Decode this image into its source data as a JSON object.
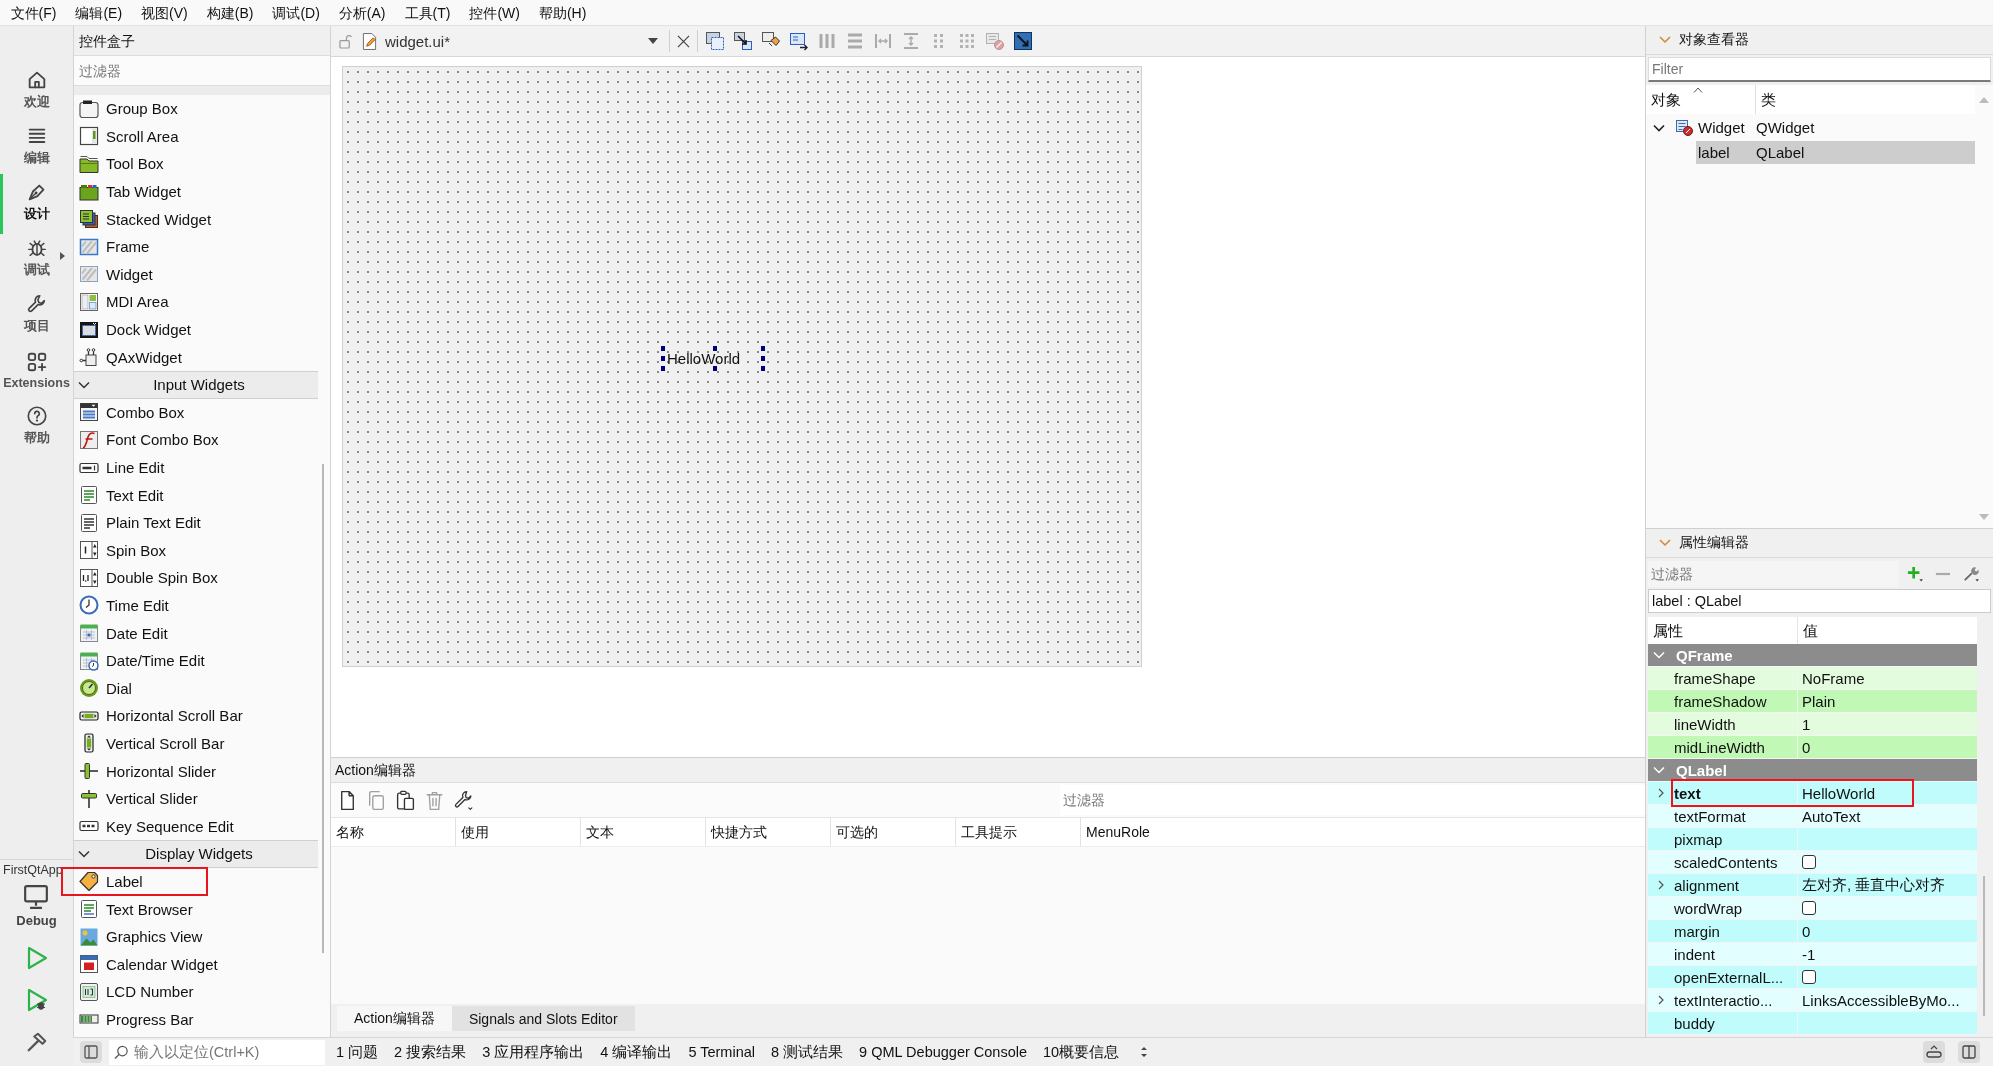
{
  "menu_bar": [
    "文件(F)",
    "编辑(E)",
    "视图(V)",
    "构建(B)",
    "调试(D)",
    "分析(A)",
    "工具(T)",
    "控件(W)",
    "帮助(H)"
  ],
  "mode_bar": {
    "modes": [
      {
        "label": "欢迎",
        "kind": "welcome",
        "selected": false,
        "submenu": false
      },
      {
        "label": "编辑",
        "kind": "edit",
        "selected": false,
        "submenu": false
      },
      {
        "label": "设计",
        "kind": "design",
        "selected": true,
        "submenu": false
      },
      {
        "label": "调试",
        "kind": "debug",
        "selected": false,
        "submenu": true
      },
      {
        "label": "项目",
        "kind": "projects",
        "selected": false,
        "submenu": false
      },
      {
        "label": "Extensions",
        "kind": "extensions",
        "selected": false,
        "submenu": false
      },
      {
        "label": "帮助",
        "kind": "help",
        "selected": false,
        "submenu": false
      }
    ],
    "project": "FirstQtApp",
    "build_config": "Debug"
  },
  "widget_box": {
    "title": "控件盒子",
    "filter": {
      "placeholder": "过滤器"
    },
    "categories": [
      {
        "items": [
          {
            "label": "Group Box",
            "kind": "groupbox",
            "highlighted": false
          },
          {
            "label": "Scroll Area",
            "kind": "scrollarea",
            "highlighted": false
          },
          {
            "label": "Tool Box",
            "kind": "toolbox",
            "highlighted": false
          },
          {
            "label": "Tab Widget",
            "kind": "tabwidget",
            "highlighted": false
          },
          {
            "label": "Stacked Widget",
            "kind": "stacked",
            "highlighted": false
          },
          {
            "label": "Frame",
            "kind": "frame",
            "highlighted": false
          },
          {
            "label": "Widget",
            "kind": "widget",
            "highlighted": false
          },
          {
            "label": "MDI Area",
            "kind": "mdi",
            "highlighted": false
          },
          {
            "label": "Dock Widget",
            "kind": "dock",
            "highlighted": false
          },
          {
            "label": "QAxWidget",
            "kind": "qax",
            "highlighted": false
          }
        ]
      },
      {
        "name": "Input Widgets",
        "expanded": true,
        "items": [
          {
            "label": "Combo Box",
            "kind": "combo",
            "highlighted": false
          },
          {
            "label": "Font Combo Box",
            "kind": "fontcombo",
            "highlighted": false
          },
          {
            "label": "Line Edit",
            "kind": "lineedit",
            "highlighted": false
          },
          {
            "label": "Text Edit",
            "kind": "textedit",
            "highlighted": false
          },
          {
            "label": "Plain Text Edit",
            "kind": "plaintext",
            "highlighted": false
          },
          {
            "label": "Spin Box",
            "kind": "spinbox",
            "highlighted": false
          },
          {
            "label": "Double Spin Box",
            "kind": "doublespin",
            "highlighted": false
          },
          {
            "label": "Time Edit",
            "kind": "timeedit",
            "highlighted": false
          },
          {
            "label": "Date Edit",
            "kind": "dateedit",
            "highlighted": false
          },
          {
            "label": "Date/Time Edit",
            "kind": "datetime",
            "highlighted": false
          },
          {
            "label": "Dial",
            "kind": "dial",
            "highlighted": false
          },
          {
            "label": "Horizontal Scroll Bar",
            "kind": "hscroll",
            "highlighted": false
          },
          {
            "label": "Vertical Scroll Bar",
            "kind": "vscroll",
            "highlighted": false
          },
          {
            "label": "Horizontal Slider",
            "kind": "hslider",
            "highlighted": false
          },
          {
            "label": "Vertical Slider",
            "kind": "vslider",
            "highlighted": false
          },
          {
            "label": "Key Sequence Edit",
            "kind": "keyseq",
            "highlighted": false
          }
        ]
      },
      {
        "name": "Display Widgets",
        "expanded": true,
        "items": [
          {
            "label": "Label",
            "kind": "label",
            "highlighted": true
          },
          {
            "label": "Text Browser",
            "kind": "textbrowser",
            "highlighted": false
          },
          {
            "label": "Graphics View",
            "kind": "graphics",
            "highlighted": false
          },
          {
            "label": "Calendar Widget",
            "kind": "calendar",
            "highlighted": false
          },
          {
            "label": "LCD Number",
            "kind": "lcd",
            "highlighted": false
          },
          {
            "label": "Progress Bar",
            "kind": "progress",
            "highlighted": false
          }
        ]
      }
    ]
  },
  "form_editor": {
    "file": "widget.ui*",
    "tools": [
      {
        "kind": "editwidgets",
        "disabled": false
      },
      {
        "kind": "signals",
        "disabled": false
      },
      {
        "kind": "buddies",
        "disabled": false
      },
      {
        "kind": "taborder",
        "disabled": false
      },
      {
        "kind": "hlayout",
        "disabled": true
      },
      {
        "kind": "vlayout",
        "disabled": true
      },
      {
        "kind": "hsplit",
        "disabled": true
      },
      {
        "kind": "vsplit",
        "disabled": true
      },
      {
        "kind": "formlayout",
        "disabled": true
      },
      {
        "kind": "grid",
        "disabled": true
      },
      {
        "kind": "breaklayout",
        "disabled": true
      },
      {
        "kind": "adjustsize",
        "disabled": false
      }
    ],
    "form": {
      "label": {
        "text": "HelloWorld",
        "selected": true
      }
    }
  },
  "action_editor": {
    "title": "Action编辑器",
    "tools": [
      {
        "kind": "new",
        "disabled": false
      },
      {
        "kind": "copy",
        "disabled": true
      },
      {
        "kind": "paste",
        "disabled": false
      },
      {
        "kind": "delete",
        "disabled": true
      },
      {
        "kind": "configure",
        "disabled": false
      }
    ],
    "filter": {
      "placeholder": "过滤器"
    },
    "columns": [
      "名称",
      "使用",
      "文本",
      "快捷方式",
      "可选的",
      "工具提示",
      "MenuRole"
    ],
    "tabs": [
      {
        "label": "Action编辑器",
        "selected": true
      },
      {
        "label": "Signals and Slots Editor",
        "selected": false
      }
    ]
  },
  "object_inspector": {
    "title": "对象查看器",
    "filter": {
      "placeholder": "Filter"
    },
    "columns": [
      {
        "label": "对象",
        "sorted": true
      },
      {
        "label": "类",
        "sorted": false
      }
    ],
    "tree": [
      {
        "name": "Widget",
        "class": "QWidget",
        "kind": "form",
        "expanded": true,
        "selected": false,
        "children": [
          {
            "name": "label",
            "class": "QLabel",
            "selected": true
          }
        ]
      }
    ]
  },
  "property_editor": {
    "title": "属性编辑器",
    "filter": {
      "placeholder": "过滤器"
    },
    "object": "label : QLabel",
    "columns": [
      "属性",
      "值"
    ],
    "groups": [
      {
        "name": "QFrame",
        "expanded": true,
        "color": "#c2f8b6",
        "rows": [
          {
            "name": "frameShape",
            "kind": "text",
            "value": "NoFrame",
            "modified": false,
            "expandable": false,
            "highlighted": false
          },
          {
            "name": "frameShadow",
            "kind": "text",
            "value": "Plain",
            "modified": false,
            "expandable": false,
            "highlighted": false
          },
          {
            "name": "lineWidth",
            "kind": "text",
            "value": "1",
            "modified": false,
            "expandable": false,
            "highlighted": false
          },
          {
            "name": "midLineWidth",
            "kind": "text",
            "value": "0",
            "modified": false,
            "expandable": false,
            "highlighted": false
          }
        ]
      },
      {
        "name": "QLabel",
        "expanded": true,
        "color": "#c0fcfc",
        "rows": [
          {
            "name": "text",
            "kind": "text",
            "value": "HelloWorld",
            "modified": true,
            "expandable": true,
            "highlighted": true
          },
          {
            "name": "textFormat",
            "kind": "text",
            "value": "AutoText",
            "modified": false,
            "expandable": false,
            "highlighted": false
          },
          {
            "name": "pixmap",
            "kind": "text",
            "modified": false,
            "expandable": false,
            "highlighted": false
          },
          {
            "name": "scaledContents",
            "kind": "checkbox",
            "checked": false,
            "modified": false,
            "expandable": false,
            "highlighted": false
          },
          {
            "name": "alignment",
            "kind": "text",
            "value": "左对齐, 垂直中心对齐",
            "modified": false,
            "expandable": true,
            "highlighted": false
          },
          {
            "name": "wordWrap",
            "kind": "checkbox",
            "checked": false,
            "modified": false,
            "expandable": false,
            "highlighted": false
          },
          {
            "name": "margin",
            "kind": "text",
            "value": "0",
            "modified": false,
            "expandable": false,
            "highlighted": false
          },
          {
            "name": "indent",
            "kind": "text",
            "value": "-1",
            "modified": false,
            "expandable": false,
            "highlighted": false
          },
          {
            "name": "openExternalL...",
            "kind": "checkbox",
            "checked": false,
            "modified": false,
            "expandable": false,
            "highlighted": false
          },
          {
            "name": "textInteractio...",
            "kind": "text",
            "value": "LinksAccessibleByMo...",
            "modified": false,
            "expandable": true,
            "highlighted": false
          },
          {
            "name": "buddy",
            "kind": "text",
            "modified": false,
            "expandable": false,
            "highlighted": false
          }
        ]
      }
    ]
  },
  "status_bar": {
    "locator": {
      "placeholder": "输入以定位(Ctrl+K)"
    },
    "panes": [
      "1 问题",
      "2 搜索结果",
      "3 应用程序输出",
      "4 编译输出",
      "5 Terminal",
      "8 测试结果",
      "9 QML Debugger Console",
      "10概要信息"
    ]
  }
}
